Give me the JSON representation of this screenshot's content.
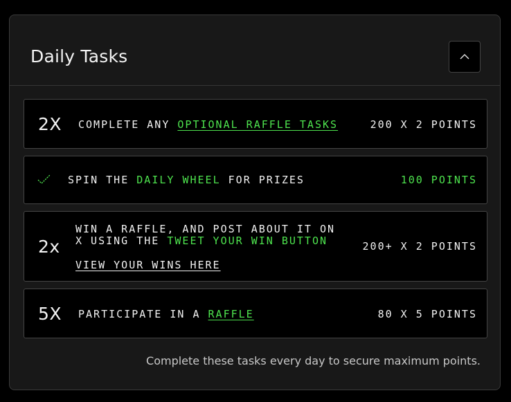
{
  "panel": {
    "title": "Daily Tasks",
    "collapse_icon": "chevron-up-icon",
    "footer": "Complete these tasks every day to secure maximum points."
  },
  "tasks": [
    {
      "multiplier": "2X",
      "text_before": "COMPLETE ANY",
      "link_text": "OPTIONAL RAFFLE TASKS",
      "points": "200 X 2 POINTS"
    },
    {
      "status_icon": "checkmark-icon",
      "text_before": "SPIN THE",
      "highlight": "DAILY WHEEL",
      "text_after": "FOR PRIZES",
      "points": "100 POINTS"
    },
    {
      "multiplier": "2x",
      "line1": "WIN A RAFFLE, AND POST ABOUT IT ON",
      "line2_before": "X USING THE",
      "line2_highlight": "TWEET YOUR WIN BUTTON",
      "link_text": "VIEW YOUR WINS HERE",
      "points": "200+ X 2 POINTS"
    },
    {
      "multiplier": "5X",
      "text_before": "PARTICIPATE IN A",
      "link_text": "RAFFLE",
      "points": "80 X 5 POINTS"
    }
  ],
  "colors": {
    "accent_green": "#4ee44e",
    "panel_bg": "#181818",
    "card_bg": "#000000"
  }
}
